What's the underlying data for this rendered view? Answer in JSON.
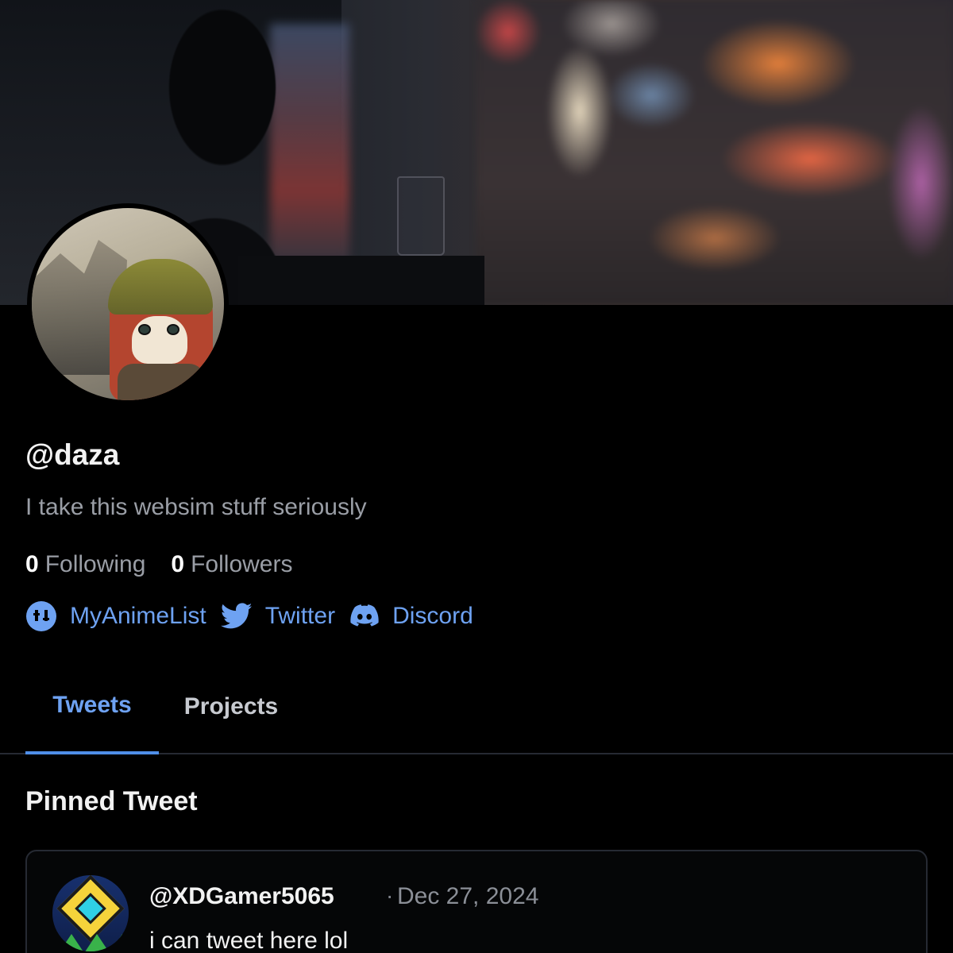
{
  "profile": {
    "handle": "@daza",
    "bio": "I take this websim stuff seriously",
    "following_count": "0",
    "following_label": "Following",
    "followers_count": "0",
    "followers_label": "Followers"
  },
  "links": [
    {
      "label": "MyAnimeList",
      "icon": "myanimelist-icon"
    },
    {
      "label": "Twitter",
      "icon": "twitter-bird-icon"
    },
    {
      "label": "Discord",
      "icon": "discord-icon"
    }
  ],
  "tabs": [
    {
      "label": "Tweets",
      "active": true
    },
    {
      "label": "Projects",
      "active": false
    }
  ],
  "pinned": {
    "heading": "Pinned Tweet",
    "tweet": {
      "username": "@XDGamer5065",
      "separator": "·",
      "date": "Dec 27, 2024",
      "text": "i can tweet here lol"
    }
  },
  "colors": {
    "background": "#000000",
    "accent": "#6ea2f2",
    "muted_text": "#9a9ea6",
    "border": "#262a33"
  }
}
